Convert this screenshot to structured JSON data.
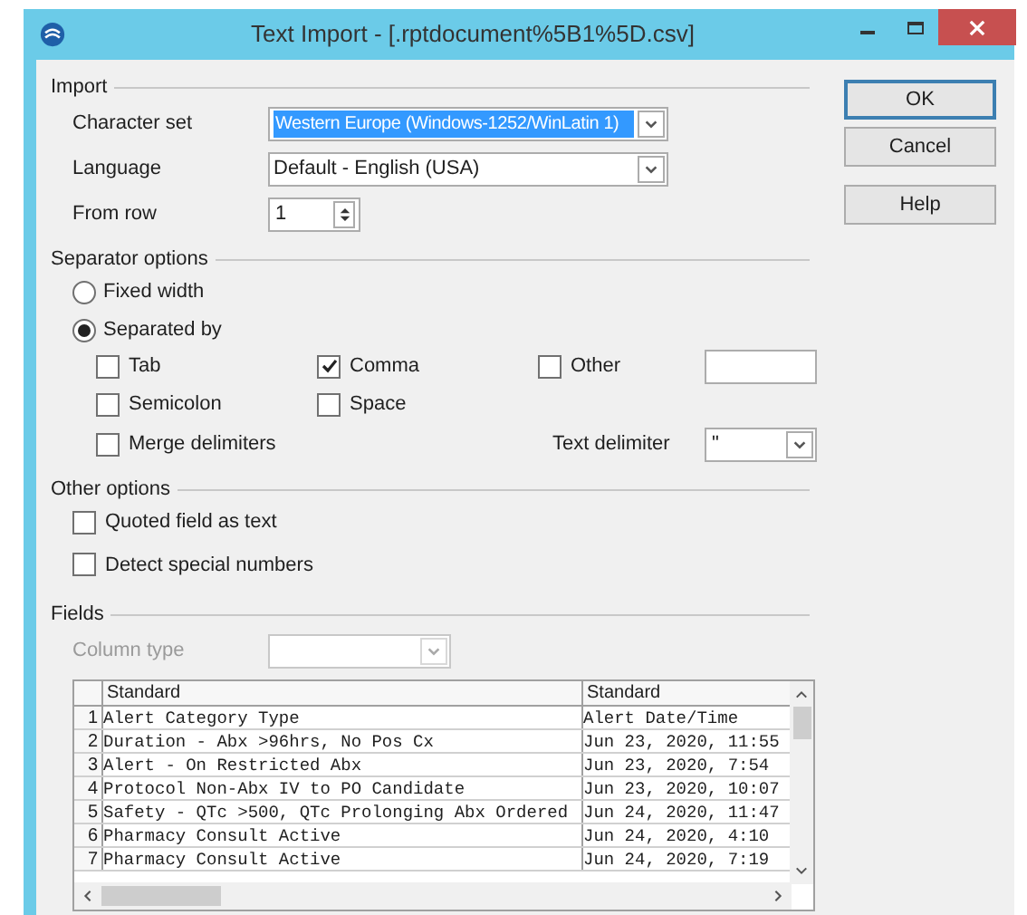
{
  "window": {
    "title": "Text Import - [.rptdocument%5B1%5D.csv]"
  },
  "import": {
    "heading": "Import",
    "character_set": {
      "label": "Character set",
      "value": "Western Europe (Windows-1252/WinLatin 1)"
    },
    "language": {
      "label": "Language",
      "value": "Default - English (USA)"
    },
    "from_row": {
      "label": "From row",
      "value": "1"
    }
  },
  "buttons": [
    {
      "label": "OK",
      "kind": "default"
    },
    {
      "label": "Cancel",
      "kind": "plain"
    },
    {
      "label": "Help",
      "kind": "gap"
    }
  ],
  "separator_options": {
    "heading": "Separator options",
    "modes": [
      {
        "label": "Fixed width",
        "selected": false
      },
      {
        "label": "Separated by",
        "selected": true
      }
    ],
    "separators": [
      {
        "label": "Tab",
        "checked": false
      },
      {
        "label": "Comma",
        "checked": true
      },
      {
        "label": "Other",
        "checked": false
      },
      {
        "label": "Semicolon",
        "checked": false
      },
      {
        "label": "Space",
        "checked": false
      }
    ],
    "merge_delimiters": {
      "label": "Merge delimiters",
      "checked": false
    },
    "text_delimiter": {
      "label": "Text delimiter",
      "value": "\""
    }
  },
  "other_options": {
    "heading": "Other options",
    "items": [
      {
        "label": "Quoted field as text",
        "checked": false
      },
      {
        "label": "Detect special numbers",
        "checked": false
      }
    ]
  },
  "fields": {
    "heading": "Fields",
    "column_type": {
      "label": "Column type",
      "disabled": true
    },
    "table": {
      "columns": [
        "",
        "Standard",
        "Standard"
      ],
      "rows": [
        [
          "1",
          "Alert Category Type",
          "Alert Date/Time"
        ],
        [
          "2",
          "Duration - Abx >96hrs, No Pos Cx",
          "Jun 23, 2020, 11:55"
        ],
        [
          "3",
          "Alert - On Restricted Abx",
          "Jun 23, 2020, 7:54"
        ],
        [
          "4",
          "Protocol Non-Abx IV to PO Candidate",
          "Jun 23, 2020, 10:07"
        ],
        [
          "5",
          "Safety - QTc >500, QTc Prolonging Abx Ordered",
          "Jun 24, 2020, 11:47"
        ],
        [
          "6",
          "Pharmacy Consult Active",
          "Jun 24, 2020, 4:10"
        ],
        [
          "7",
          "Pharmacy Consult Active",
          "Jun 24, 2020, 7:19"
        ]
      ]
    }
  }
}
